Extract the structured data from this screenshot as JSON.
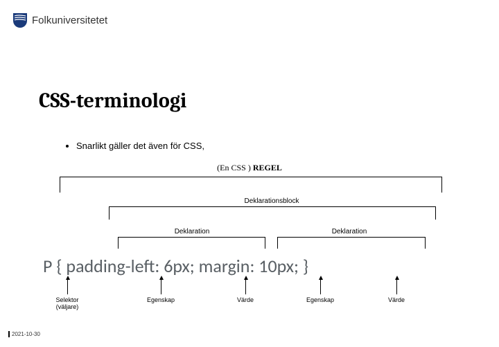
{
  "logo": {
    "text": "Folkuniversitetet"
  },
  "title": "CSS-terminologi",
  "bullet1": "Snarlikt gäller det även för CSS,",
  "regel": {
    "left": "(En CSS )",
    "right": "REGEL"
  },
  "labels": {
    "deklarationsblock": "Deklarationsblock",
    "deklaration1": "Deklaration",
    "deklaration2": "Deklaration"
  },
  "code": {
    "selector": "P",
    "brace_open": "{",
    "prop1": "padding-left:",
    "val1": "6px;",
    "prop2": "margin:",
    "val2": "10px;",
    "brace_close": "}"
  },
  "arrows": {
    "selektor": "Selektor\n(väljare)",
    "egenskap1": "Egenskap",
    "varde1": "Värde",
    "egenskap2": "Egenskap",
    "varde2": "Värde"
  },
  "date": "2021-10-30"
}
